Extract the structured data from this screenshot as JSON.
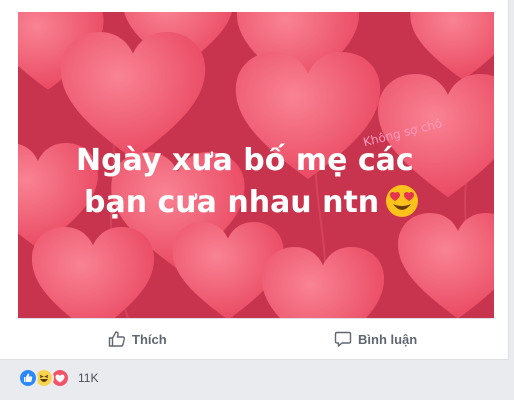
{
  "post": {
    "image_caption_line1": "Ngày xưa bố mẹ các",
    "image_caption_line2": "bạn cưa nhau ntn",
    "image_watermark": "Không sợ chó",
    "emoji_icon": "heart-eyes-emoji-icon",
    "colors": {
      "image_background": "#c8334d",
      "heart": "#f04f67",
      "heart_light": "#f7707f"
    }
  },
  "actions": {
    "like_label": "Thích",
    "comment_label": "Bình luận",
    "like_icon": "thumbs-up-outline-icon",
    "comment_icon": "speech-bubble-icon"
  },
  "reactions": {
    "icons": [
      "like-reaction-icon",
      "haha-reaction-icon",
      "love-reaction-icon"
    ],
    "count": "11K"
  }
}
